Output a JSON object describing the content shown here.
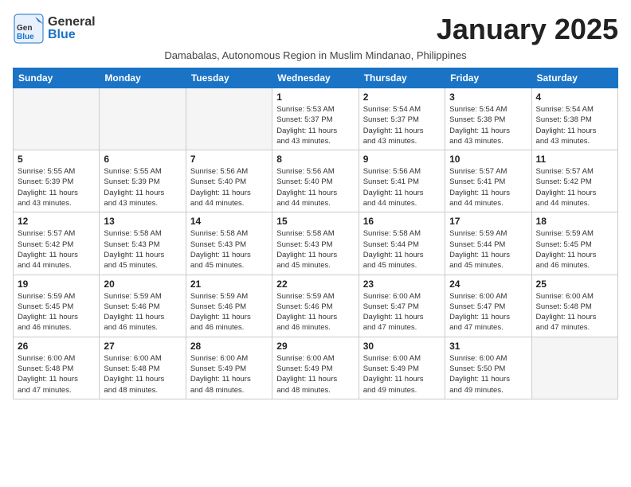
{
  "header": {
    "logo_general": "General",
    "logo_blue": "Blue",
    "month_title": "January 2025",
    "subtitle": "Damabalas, Autonomous Region in Muslim Mindanao, Philippines"
  },
  "calendar": {
    "days_of_week": [
      "Sunday",
      "Monday",
      "Tuesday",
      "Wednesday",
      "Thursday",
      "Friday",
      "Saturday"
    ],
    "weeks": [
      [
        {
          "day": "",
          "info": ""
        },
        {
          "day": "",
          "info": ""
        },
        {
          "day": "",
          "info": ""
        },
        {
          "day": "1",
          "info": "Sunrise: 5:53 AM\nSunset: 5:37 PM\nDaylight: 11 hours\nand 43 minutes."
        },
        {
          "day": "2",
          "info": "Sunrise: 5:54 AM\nSunset: 5:37 PM\nDaylight: 11 hours\nand 43 minutes."
        },
        {
          "day": "3",
          "info": "Sunrise: 5:54 AM\nSunset: 5:38 PM\nDaylight: 11 hours\nand 43 minutes."
        },
        {
          "day": "4",
          "info": "Sunrise: 5:54 AM\nSunset: 5:38 PM\nDaylight: 11 hours\nand 43 minutes."
        }
      ],
      [
        {
          "day": "5",
          "info": "Sunrise: 5:55 AM\nSunset: 5:39 PM\nDaylight: 11 hours\nand 43 minutes."
        },
        {
          "day": "6",
          "info": "Sunrise: 5:55 AM\nSunset: 5:39 PM\nDaylight: 11 hours\nand 43 minutes."
        },
        {
          "day": "7",
          "info": "Sunrise: 5:56 AM\nSunset: 5:40 PM\nDaylight: 11 hours\nand 44 minutes."
        },
        {
          "day": "8",
          "info": "Sunrise: 5:56 AM\nSunset: 5:40 PM\nDaylight: 11 hours\nand 44 minutes."
        },
        {
          "day": "9",
          "info": "Sunrise: 5:56 AM\nSunset: 5:41 PM\nDaylight: 11 hours\nand 44 minutes."
        },
        {
          "day": "10",
          "info": "Sunrise: 5:57 AM\nSunset: 5:41 PM\nDaylight: 11 hours\nand 44 minutes."
        },
        {
          "day": "11",
          "info": "Sunrise: 5:57 AM\nSunset: 5:42 PM\nDaylight: 11 hours\nand 44 minutes."
        }
      ],
      [
        {
          "day": "12",
          "info": "Sunrise: 5:57 AM\nSunset: 5:42 PM\nDaylight: 11 hours\nand 44 minutes."
        },
        {
          "day": "13",
          "info": "Sunrise: 5:58 AM\nSunset: 5:43 PM\nDaylight: 11 hours\nand 45 minutes."
        },
        {
          "day": "14",
          "info": "Sunrise: 5:58 AM\nSunset: 5:43 PM\nDaylight: 11 hours\nand 45 minutes."
        },
        {
          "day": "15",
          "info": "Sunrise: 5:58 AM\nSunset: 5:43 PM\nDaylight: 11 hours\nand 45 minutes."
        },
        {
          "day": "16",
          "info": "Sunrise: 5:58 AM\nSunset: 5:44 PM\nDaylight: 11 hours\nand 45 minutes."
        },
        {
          "day": "17",
          "info": "Sunrise: 5:59 AM\nSunset: 5:44 PM\nDaylight: 11 hours\nand 45 minutes."
        },
        {
          "day": "18",
          "info": "Sunrise: 5:59 AM\nSunset: 5:45 PM\nDaylight: 11 hours\nand 46 minutes."
        }
      ],
      [
        {
          "day": "19",
          "info": "Sunrise: 5:59 AM\nSunset: 5:45 PM\nDaylight: 11 hours\nand 46 minutes."
        },
        {
          "day": "20",
          "info": "Sunrise: 5:59 AM\nSunset: 5:46 PM\nDaylight: 11 hours\nand 46 minutes."
        },
        {
          "day": "21",
          "info": "Sunrise: 5:59 AM\nSunset: 5:46 PM\nDaylight: 11 hours\nand 46 minutes."
        },
        {
          "day": "22",
          "info": "Sunrise: 5:59 AM\nSunset: 5:46 PM\nDaylight: 11 hours\nand 46 minutes."
        },
        {
          "day": "23",
          "info": "Sunrise: 6:00 AM\nSunset: 5:47 PM\nDaylight: 11 hours\nand 47 minutes."
        },
        {
          "day": "24",
          "info": "Sunrise: 6:00 AM\nSunset: 5:47 PM\nDaylight: 11 hours\nand 47 minutes."
        },
        {
          "day": "25",
          "info": "Sunrise: 6:00 AM\nSunset: 5:48 PM\nDaylight: 11 hours\nand 47 minutes."
        }
      ],
      [
        {
          "day": "26",
          "info": "Sunrise: 6:00 AM\nSunset: 5:48 PM\nDaylight: 11 hours\nand 47 minutes."
        },
        {
          "day": "27",
          "info": "Sunrise: 6:00 AM\nSunset: 5:48 PM\nDaylight: 11 hours\nand 48 minutes."
        },
        {
          "day": "28",
          "info": "Sunrise: 6:00 AM\nSunset: 5:49 PM\nDaylight: 11 hours\nand 48 minutes."
        },
        {
          "day": "29",
          "info": "Sunrise: 6:00 AM\nSunset: 5:49 PM\nDaylight: 11 hours\nand 48 minutes."
        },
        {
          "day": "30",
          "info": "Sunrise: 6:00 AM\nSunset: 5:49 PM\nDaylight: 11 hours\nand 49 minutes."
        },
        {
          "day": "31",
          "info": "Sunrise: 6:00 AM\nSunset: 5:50 PM\nDaylight: 11 hours\nand 49 minutes."
        },
        {
          "day": "",
          "info": ""
        }
      ]
    ]
  }
}
